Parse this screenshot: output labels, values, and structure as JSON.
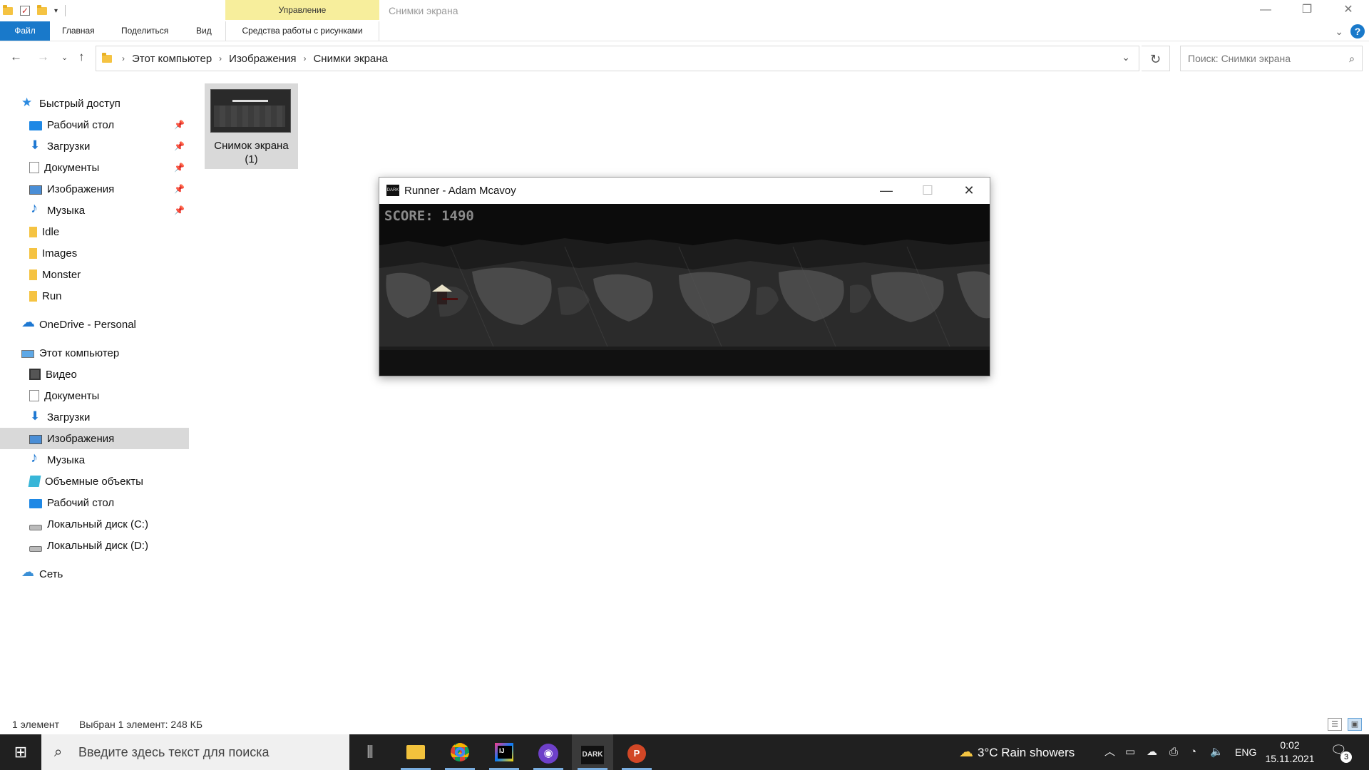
{
  "explorer": {
    "window_title": "Снимки экрана",
    "contextual_tab_header": "Управление",
    "ribbon_tabs": [
      "Файл",
      "Главная",
      "Поделиться",
      "Вид"
    ],
    "contextual_tab": "Средства работы с рисунками",
    "breadcrumb": [
      "Этот компьютер",
      "Изображения",
      "Снимки экрана"
    ],
    "search_placeholder": "Поиск: Снимки экрана",
    "help_label": "?",
    "nav": {
      "quick_access": "Быстрый доступ",
      "quick_items": [
        "Рабочий стол",
        "Загрузки",
        "Документы",
        "Изображения",
        "Музыка",
        "Idle",
        "Images",
        "Monster",
        "Run"
      ],
      "onedrive": "OneDrive - Personal",
      "this_pc": "Этот компьютер",
      "pc_items": [
        "Видео",
        "Документы",
        "Загрузки",
        "Изображения",
        "Музыка",
        "Объемные объекты",
        "Рабочий стол",
        "Локальный диск (C:)",
        "Локальный диск (D:)"
      ],
      "network": "Сеть"
    },
    "file": {
      "name_line1": "Снимок экрана",
      "name_line2": "(1)"
    },
    "status": {
      "count": "1 элемент",
      "selected": "Выбран 1 элемент: 248 КБ"
    }
  },
  "game_window": {
    "title": "Runner - Adam Mcavoy",
    "icon_text": "DARK",
    "score_text": "SCORE: 1490"
  },
  "taskbar": {
    "search_placeholder": "Введите здесь текст для поиска",
    "apps": [
      "task-view",
      "file-explorer",
      "chrome",
      "intellij-idea",
      "github-desktop",
      "dark-runner",
      "powerpoint"
    ],
    "dark_app_label": "DARK",
    "ij_label": "IJ",
    "pp_label": "P",
    "weather": "3°C  Rain showers",
    "language": "ENG",
    "time": "0:02",
    "date": "15.11.2021",
    "notification_count": "3"
  }
}
